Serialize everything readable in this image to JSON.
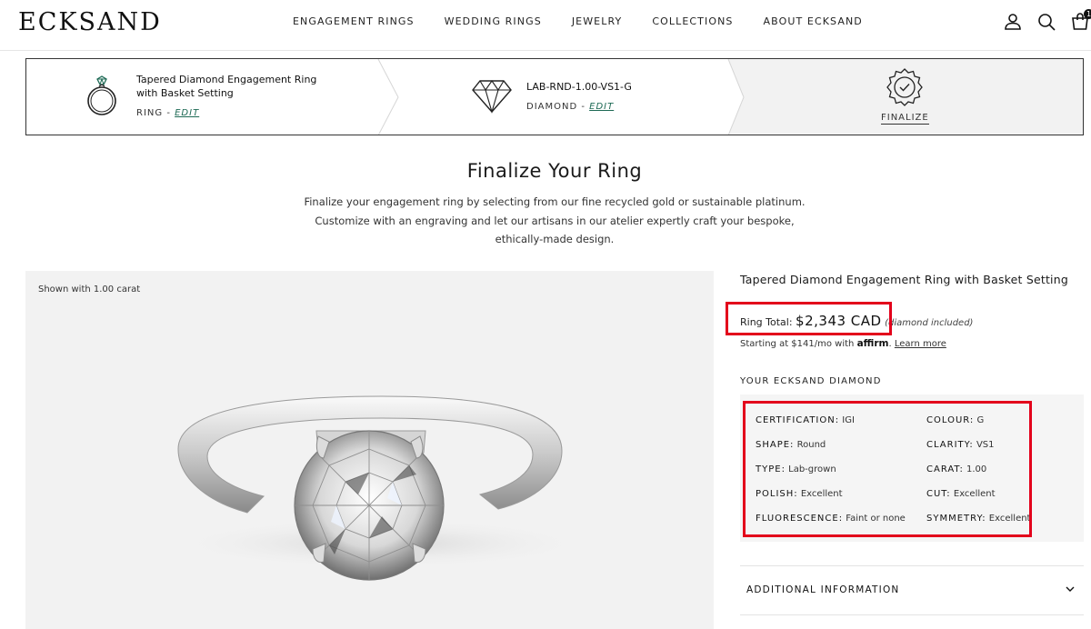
{
  "header": {
    "logo": "ECKSAND",
    "nav": [
      "ENGAGEMENT RINGS",
      "WEDDING RINGS",
      "JEWELRY",
      "COLLECTIONS",
      "ABOUT ECKSAND"
    ],
    "cart_count": "1",
    "icons": [
      "user-icon",
      "search-icon",
      "cart-icon"
    ]
  },
  "steps": {
    "ring": {
      "title": "Tapered Diamond Engagement Ring with Basket Setting",
      "type": "RING",
      "edit": "EDIT"
    },
    "diamond": {
      "title": "LAB-RND-1.00-VS1-G",
      "type": "DIAMOND",
      "edit": "EDIT"
    },
    "finalize": {
      "label": "FINALIZE"
    },
    "separator": " - "
  },
  "page": {
    "title": "Finalize Your Ring",
    "intro": "Finalize your engagement ring by selecting from our fine recycled gold or sustainable platinum. Customize with an engraving and let our artisans in our atelier expertly craft your bespoke, ethically-made design."
  },
  "image": {
    "caption": "Shown with 1.00 carat"
  },
  "product": {
    "name": "Tapered Diamond Engagement Ring with Basket Setting",
    "price_label": "Ring Total:",
    "price": "$2,343 CAD",
    "price_note": "(diamond included)",
    "financing_text": "Starting at $141/mo with",
    "financing_brand": "affirm",
    "financing_link": "Learn more",
    "diamond_section": "YOUR ECKSAND DIAMOND",
    "specs_left": [
      {
        "key": "CERTIFICATION:",
        "value": "IGI"
      },
      {
        "key": "SHAPE:",
        "value": "Round"
      },
      {
        "key": "TYPE:",
        "value": "Lab-grown"
      },
      {
        "key": "POLISH:",
        "value": "Excellent"
      },
      {
        "key": "FLUORESCENCE:",
        "value": "Faint or none"
      }
    ],
    "specs_right": [
      {
        "key": "COLOUR:",
        "value": "G"
      },
      {
        "key": "CLARITY:",
        "value": "VS1"
      },
      {
        "key": "CARAT:",
        "value": "1.00"
      },
      {
        "key": "CUT:",
        "value": "Excellent"
      },
      {
        "key": "SYMMETRY:",
        "value": "Excellent"
      }
    ],
    "accordion": "ADDITIONAL INFORMATION"
  },
  "colors": {
    "accent_green": "#1e6a55",
    "highlight_red": "#e3001b",
    "panel_gray": "#f2f2f2"
  }
}
